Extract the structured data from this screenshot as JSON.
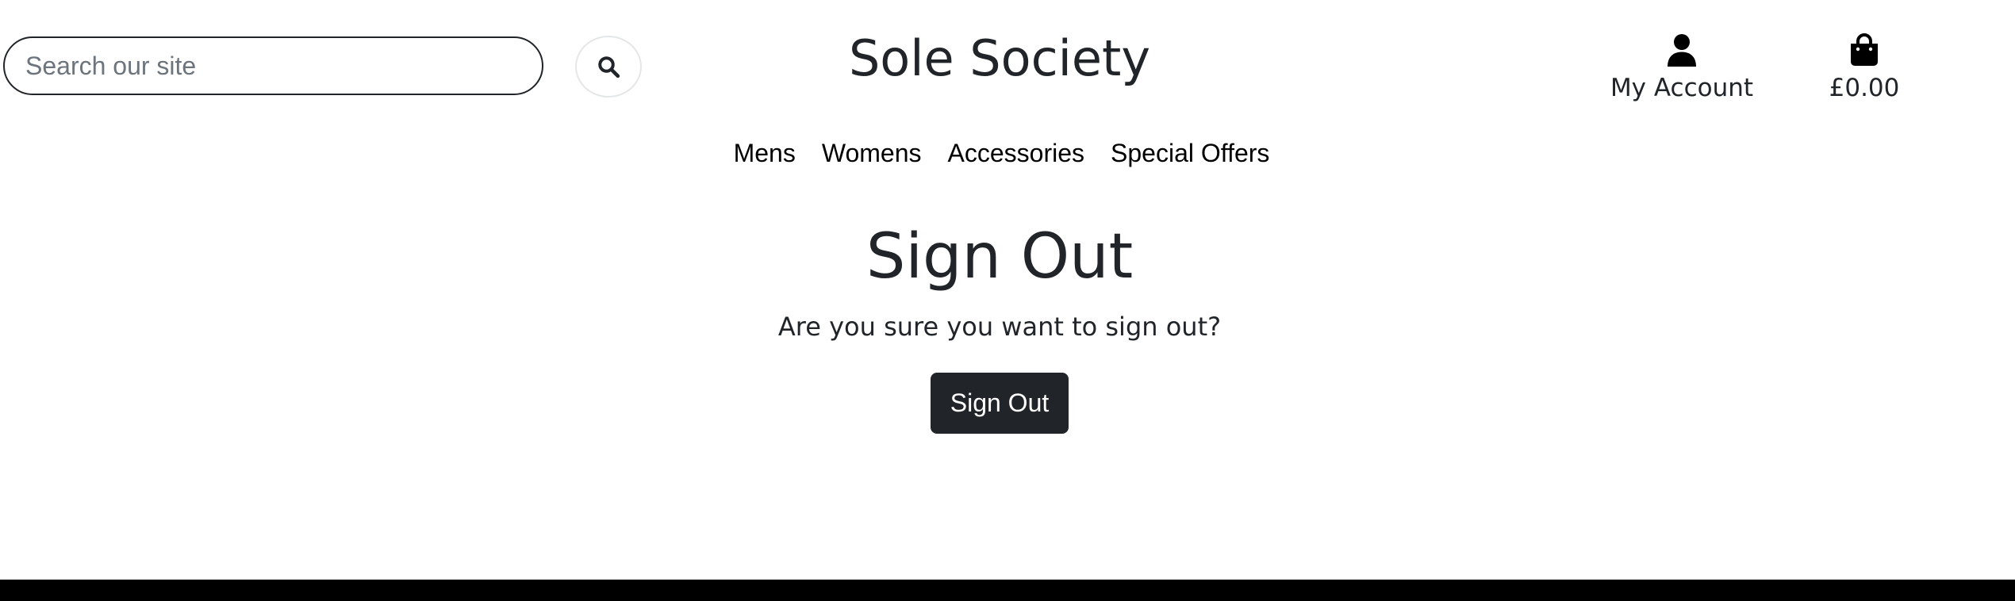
{
  "header": {
    "search": {
      "placeholder": "Search our site",
      "value": "",
      "icon": "search-icon"
    },
    "site_title": "Sole Society",
    "account": {
      "icon": "user-icon",
      "label": "My Account"
    },
    "bag": {
      "icon": "shopping-bag-icon",
      "total": "£0.00"
    }
  },
  "nav": {
    "items": [
      {
        "label": "Mens"
      },
      {
        "label": "Womens"
      },
      {
        "label": "Accessories"
      },
      {
        "label": "Special Offers"
      }
    ]
  },
  "main": {
    "title": "Sign Out",
    "message": "Are you sure you want to sign out?",
    "signout_button": "Sign Out"
  },
  "colors": {
    "text": "#212529",
    "button_background": "#212529",
    "button_text": "#ffffff",
    "footer": "#000000",
    "placeholder": "#6c757d"
  }
}
